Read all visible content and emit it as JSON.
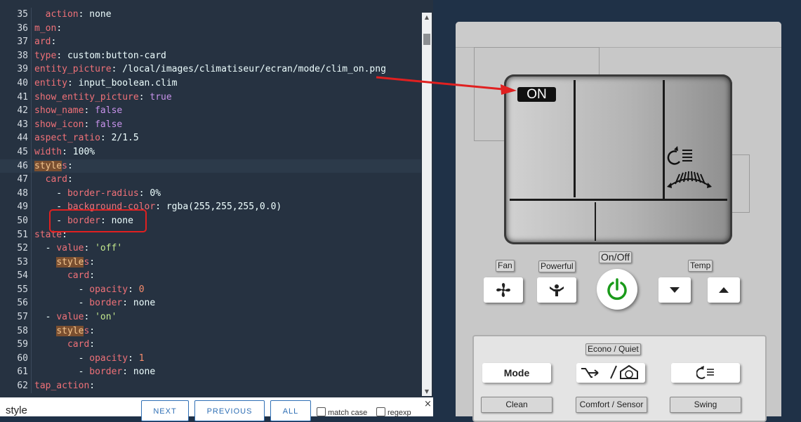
{
  "editor": {
    "lines": [
      {
        "n": "35",
        "html": "<span class='k'>  action</span>: none"
      },
      {
        "n": "36",
        "html": "<span class='k'>m_on</span>:"
      },
      {
        "n": "37",
        "html": "<span class='k'>ard</span>:"
      },
      {
        "n": "38",
        "html": "<span class='k'>type</span>: custom:button-card"
      },
      {
        "n": "39",
        "html": "<span class='k'>entity_picture</span>: /local/images/climatiseur/ecran/mode/clim_on.png"
      },
      {
        "n": "40",
        "html": "<span class='k'>entity</span>: input_boolean.clim"
      },
      {
        "n": "41",
        "html": "<span class='k'>show_entity_picture</span>: <span class='kw'>true</span>"
      },
      {
        "n": "42",
        "html": "<span class='k'>show_name</span>: <span class='kw'>false</span>"
      },
      {
        "n": "43",
        "html": "<span class='k'>show_icon</span>: <span class='kw'>false</span>"
      },
      {
        "n": "44",
        "html": "<span class='k'>aspect_ratio</span>: 2/1.5"
      },
      {
        "n": "45",
        "html": "<span class='k'>width</span>: 100%"
      },
      {
        "n": "46",
        "html": "<span class='k'><span class='hl'>style</span>s</span>:",
        "active": true
      },
      {
        "n": "47",
        "html": "  <span class='k'>card</span>:"
      },
      {
        "n": "48",
        "html": "    - <span class='k'>border-radius</span>: 0%"
      },
      {
        "n": "49",
        "html": "    - <span class='k'>background-color</span>: rgba(255,255,255,0.0)"
      },
      {
        "n": "50",
        "html": "    - <span class='k'>border</span>: none"
      },
      {
        "n": "51",
        "html": "<span class='k'>state</span>:"
      },
      {
        "n": "52",
        "html": "  - <span class='k'>value</span>: <span class='str'>'off'</span>"
      },
      {
        "n": "53",
        "html": "    <span class='k'><span class='hl'>style</span>s</span>:"
      },
      {
        "n": "54",
        "html": "      <span class='k'>card</span>:"
      },
      {
        "n": "55",
        "html": "        - <span class='k'>opacity</span>: <span class='num'>0</span>"
      },
      {
        "n": "56",
        "html": "        - <span class='k'>border</span>: none"
      },
      {
        "n": "57",
        "html": "  - <span class='k'>value</span>: <span class='str'>'on'</span>"
      },
      {
        "n": "58",
        "html": "    <span class='k'><span class='hl'>style</span>s</span>:"
      },
      {
        "n": "59",
        "html": "      <span class='k'>card</span>:"
      },
      {
        "n": "60",
        "html": "        - <span class='k'>opacity</span>: <span class='num'>1</span>"
      },
      {
        "n": "61",
        "html": "        - <span class='k'>border</span>: none"
      },
      {
        "n": "62",
        "html": "<span class='k'>tap_action</span>:"
      }
    ]
  },
  "search": {
    "value": "style",
    "next": "NEXT",
    "previous": "PREVIOUS",
    "all": "ALL",
    "match_case": "match case",
    "regexp": "regexp",
    "close": "×"
  },
  "remote": {
    "screen_status": "ON",
    "labels": {
      "fan": "Fan",
      "powerful": "Powerful",
      "on_off": "On/Off",
      "temp": "Temp",
      "econo_quiet": "Econo / Quiet"
    },
    "buttons": {
      "mode": "Mode",
      "clean": "Clean",
      "comfort_sensor": "Comfort / Sensor",
      "swing": "Swing"
    },
    "colors": {
      "power_icon": "#1a9a1a",
      "accent_red": "#e02020"
    }
  }
}
